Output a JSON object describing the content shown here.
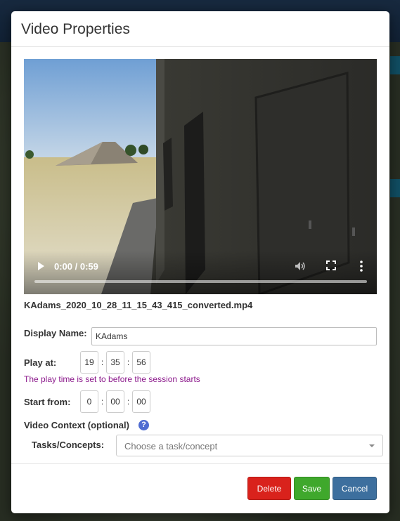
{
  "dialog": {
    "title": "Video Properties"
  },
  "video": {
    "time_readout": "0:00 / 0:59",
    "progress": 0,
    "filename": "KAdams_2020_10_28_11_15_43_415_converted.mp4"
  },
  "form": {
    "display_name_label": "Display Name:",
    "display_name_value": "KAdams",
    "play_at_label": "Play at:",
    "play_at": {
      "hour": "19",
      "minute": "35",
      "second": "56"
    },
    "time_separator": ":",
    "play_time_warning": "The play time is set to before the session starts",
    "start_from_label": "Start from:",
    "start_from": {
      "hour": "0",
      "minute": "00",
      "second": "00"
    },
    "video_context_label": "Video Context (optional)",
    "help_glyph": "?",
    "tasks_label": "Tasks/Concepts:",
    "tasks_placeholder": "Choose a task/concept"
  },
  "footer": {
    "delete_label": "Delete",
    "save_label": "Save",
    "cancel_label": "Cancel"
  },
  "colors": {
    "delete": "#d9221c",
    "save": "#3fa82c",
    "cancel": "#3d6f9e",
    "warning_text": "#8c1a8c",
    "help_icon": "#4f6cd1"
  },
  "icons": [
    "play-icon",
    "volume-icon",
    "fullscreen-icon",
    "more-vert-icon",
    "help-icon",
    "chevron-down-icon"
  ]
}
